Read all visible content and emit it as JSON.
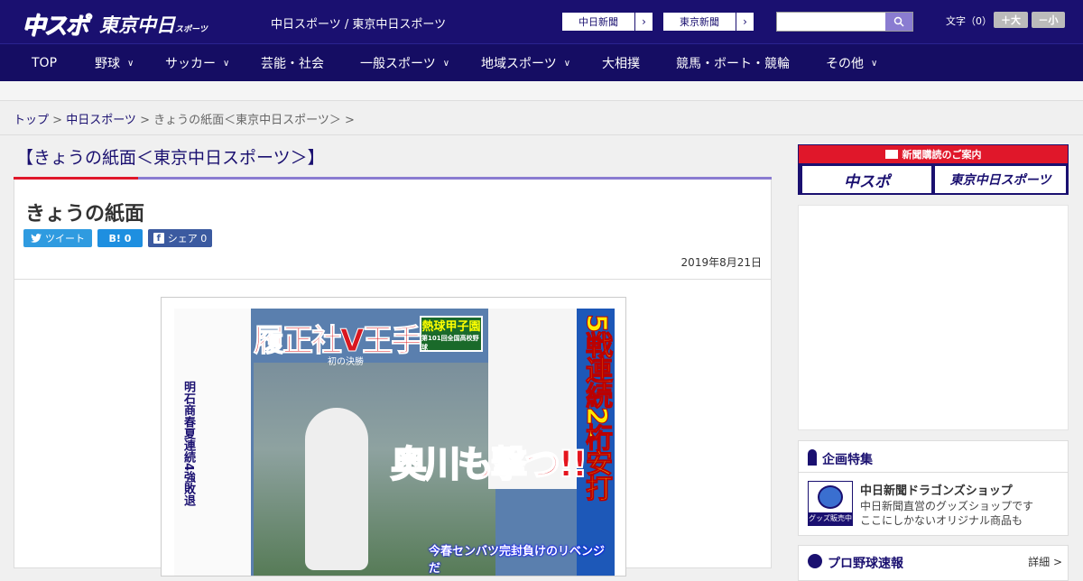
{
  "header": {
    "logo_chuspo": "中スポ",
    "logo_tokyo": "東京中日",
    "logo_tokyo_small": "スポーツ",
    "tagline": "中日スポーツ / 東京中日スポーツ",
    "pill_chunichi": "中日新聞",
    "pill_tokyo": "東京新聞",
    "search_placeholder": "",
    "font_label": "文字（0）",
    "font_plus": "＋大",
    "font_minus": "－小"
  },
  "nav": {
    "items": [
      "TOP",
      "野球",
      "サッカー",
      "芸能・社会",
      "一般スポーツ",
      "地域スポーツ",
      "大相撲",
      "競馬・ボート・競輪",
      "その他"
    ]
  },
  "breadcrumb": {
    "top": "トップ",
    "sep": " > ",
    "chunichi": "中日スポーツ",
    "current": "きょうの紙面＜東京中日スポーツ＞"
  },
  "page": {
    "heading": "【きょうの紙面＜東京中日スポーツ＞】",
    "title": "きょうの紙面",
    "tweet": "ツイート",
    "hatena": "B! 0",
    "share": "シェア 0",
    "date": "2019年8月21日"
  },
  "newspaper": {
    "headline1": "履正社V王手",
    "sub": "初の決勝",
    "badge": "熱球甲子園",
    "badge_sub": "第101回全国高校野球",
    "left_vertical": "明石商春夏連続4強敗退",
    "right_vertical": "5戦連続2桁安打",
    "headline2": "奥川も撃つ!!",
    "caption": "今春センバツ完封負けのリベンジだ"
  },
  "sidebar": {
    "promo_head": "新聞購読のご案内",
    "promo_chuspo": "中スポ",
    "promo_tokyo": "東京中日スポーツ",
    "feature_head": "企画特集",
    "feature_title": "中日新聞ドラゴンズショップ",
    "feature_desc1": "中日新聞直営のグッズショップです",
    "feature_desc2": "ここにしかないオリジナル商品も",
    "feature_img_label": "グッズ販売中",
    "pro_title": "プロ野球速報",
    "pro_detail": "詳細 >"
  },
  "colors": {
    "brand": "#1a1070",
    "accent_red": "#e0172a",
    "accent_purple": "#8a7cd1"
  }
}
